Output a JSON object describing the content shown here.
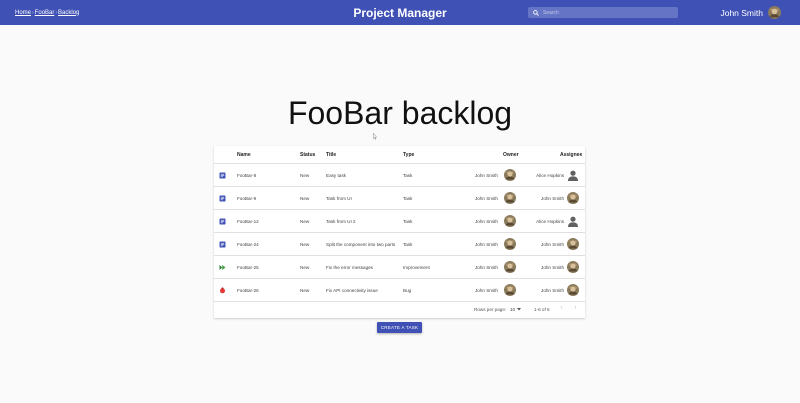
{
  "header": {
    "breadcrumbs": [
      "Home",
      "FooBar",
      "Backlog"
    ],
    "breadcrumb_separator": "›",
    "app_title": "Project Manager",
    "search_placeholder": "Search",
    "user_name": "John Smith",
    "bar_color": "#3f51b5"
  },
  "main": {
    "title": "FooBar backlog"
  },
  "table": {
    "columns": {
      "name": "Name",
      "status": "Status",
      "title": "Title",
      "type": "Type",
      "owner": "Owner",
      "assignee": "Assignee"
    },
    "rows": [
      {
        "icon": "task-icon",
        "name": "FooBar-8",
        "status": "New",
        "title": "Easy task",
        "type": "Task",
        "owner": "John Smith",
        "assignee": "Alice Hopkins",
        "assignee_avatar": "placeholder"
      },
      {
        "icon": "task-icon",
        "name": "FooBar-9",
        "status": "New",
        "title": "Task from UI",
        "type": "Task",
        "owner": "John Smith",
        "assignee": "John Smith",
        "assignee_avatar": "photo"
      },
      {
        "icon": "task-icon",
        "name": "FooBar-12",
        "status": "New",
        "title": "Task from UI 2",
        "type": "Task",
        "owner": "John Smith",
        "assignee": "Alice Hopkins",
        "assignee_avatar": "placeholder"
      },
      {
        "icon": "task-icon",
        "name": "FooBar-24",
        "status": "New",
        "title": "Split the component into two parts",
        "type": "Task",
        "owner": "John Smith",
        "assignee": "John Smith",
        "assignee_avatar": "photo"
      },
      {
        "icon": "improvement-icon",
        "name": "FooBar-25",
        "status": "New",
        "title": "Fix the error messages",
        "type": "Improvement",
        "owner": "John Smith",
        "assignee": "John Smith",
        "assignee_avatar": "photo"
      },
      {
        "icon": "bug-icon",
        "name": "FooBar-26",
        "status": "New",
        "title": "Fix API connectivity issue",
        "type": "Bug",
        "owner": "John Smith",
        "assignee": "John Smith",
        "assignee_avatar": "photo"
      }
    ],
    "footer": {
      "rows_per_page_label": "Rows per page:",
      "rows_per_page": "10",
      "range": "1-6 of 6"
    }
  },
  "actions": {
    "create_label": "Create a task"
  }
}
